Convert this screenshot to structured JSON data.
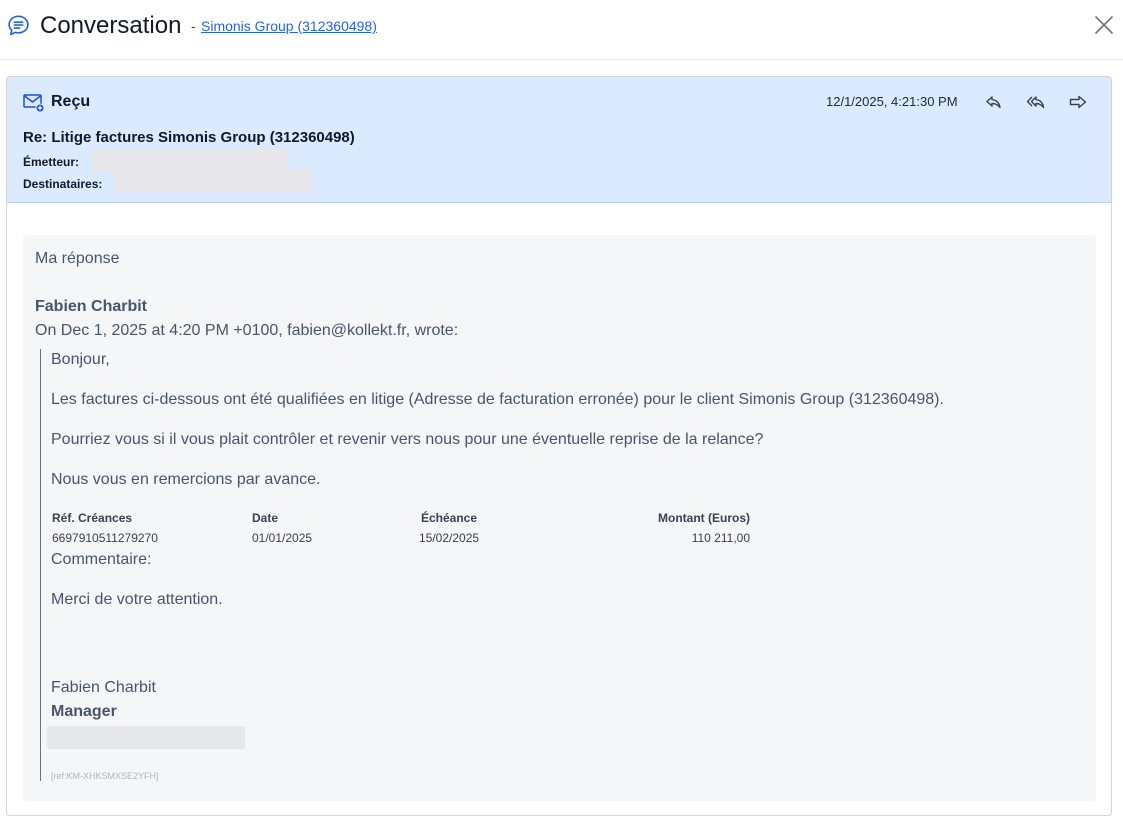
{
  "header": {
    "title": "Conversation",
    "separator": "-",
    "customer_link": "Simonis Group (312360498)",
    "icons": {
      "chat": "chat-bubble-icon",
      "close": "close-icon"
    }
  },
  "message": {
    "status": "Reçu",
    "timestamp": "12/1/2025, 4:21:30 PM",
    "subject": "Re: Litige factures Simonis Group (312360498)",
    "sender_label": "Émetteur:",
    "recipients_label": "Destinataires:",
    "icons": {
      "status": "mail-received-icon",
      "reply": "reply-icon",
      "reply_all": "reply-all-icon",
      "forward": "forward-icon"
    },
    "colors": {
      "header_bg": "#dbeafe",
      "link": "#2563eb",
      "accent": "#1d4ed8"
    }
  },
  "body": {
    "reply_text": "Ma réponse",
    "quoted_author": "Fabien Charbit",
    "quoted_meta": "On Dec 1, 2025 at 4:20 PM +0100, fabien@kollekt.fr, wrote:",
    "greeting": "Bonjour,",
    "paragraph1": "Les factures ci-dessous ont été qualifiées en litige (Adresse de facturation erronée) pour le client Simonis Group (312360498).",
    "paragraph2": "Pourriez vous si il vous plait contrôler et revenir vers nous pour une éventuelle reprise de la relance?",
    "paragraph3": "Nous vous en remercions par avance.",
    "table": {
      "headers": [
        "Réf. Créances",
        "Date",
        "Échéance",
        "Montant (Euros)"
      ],
      "rows": [
        [
          "6697910511279270",
          "01/01/2025",
          "15/02/2025",
          "110 211,00"
        ]
      ]
    },
    "comment_label": "Commentaire:",
    "thanks": "Merci de votre attention.",
    "signature_name": "Fabien Charbit",
    "signature_role": "Manager",
    "reference": "[ref:KM-XHKSMXSE2YFH]"
  }
}
